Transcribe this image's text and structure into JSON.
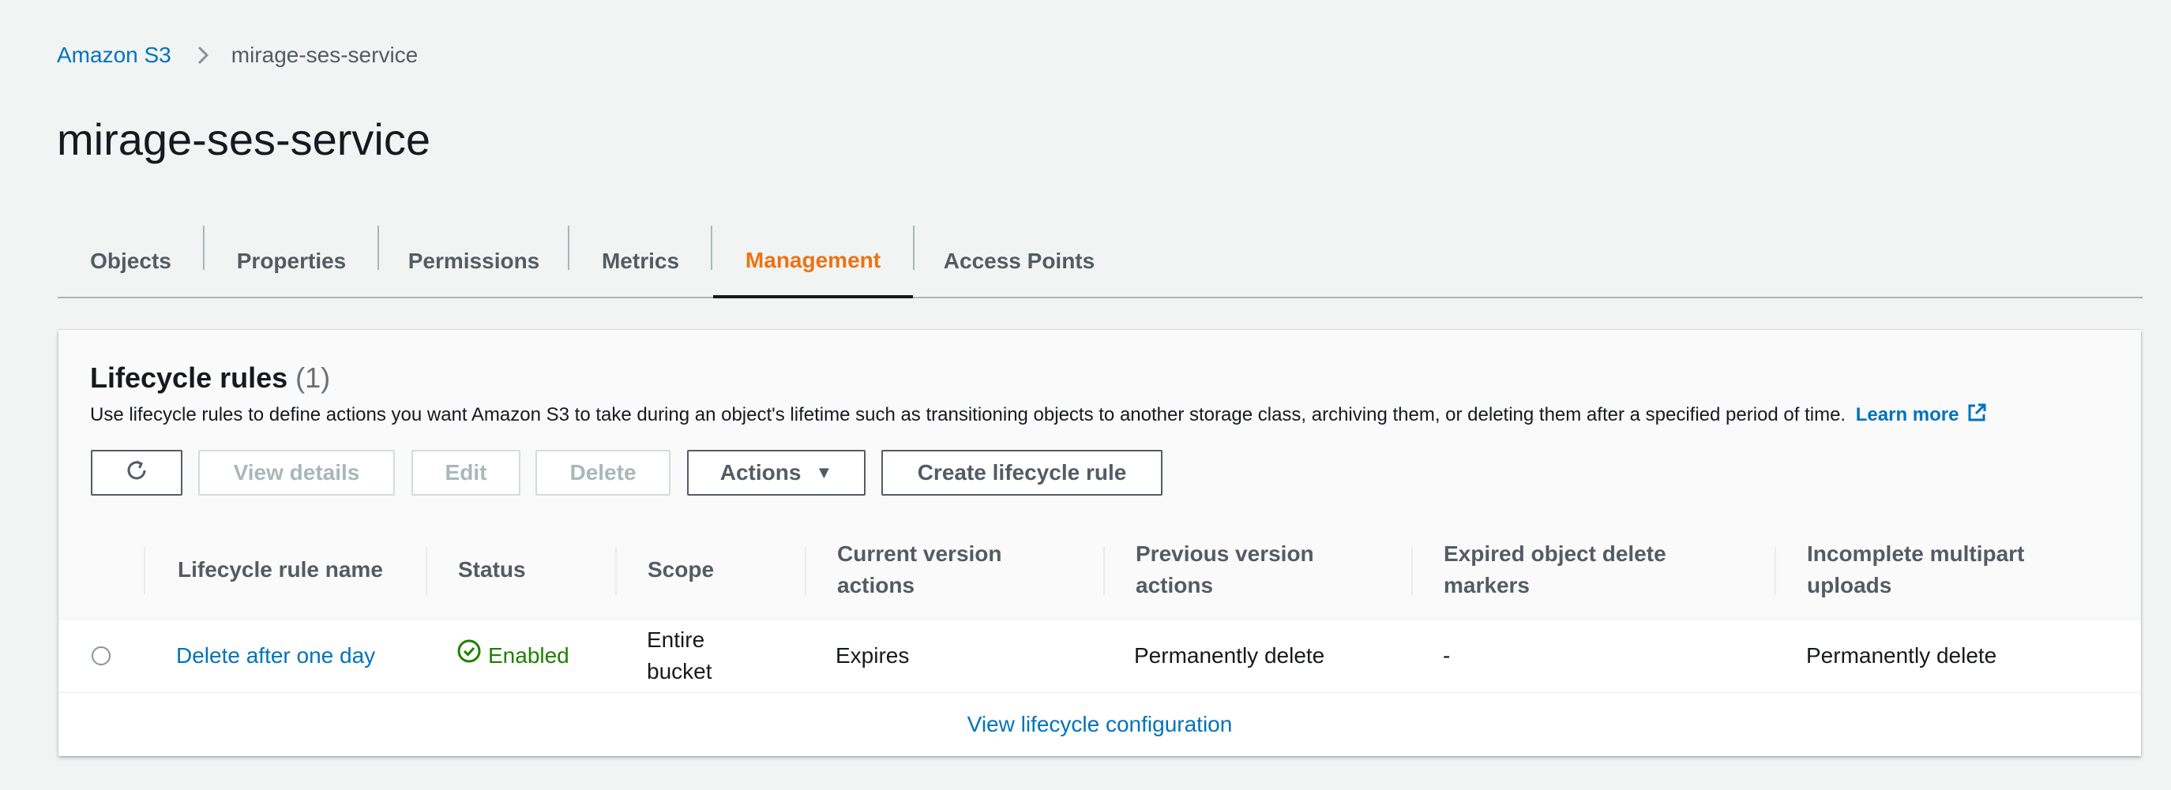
{
  "breadcrumb": {
    "root": "Amazon S3",
    "current": "mirage-ses-service"
  },
  "page": {
    "title": "mirage-ses-service"
  },
  "tabs": [
    {
      "label": "Objects",
      "active": false
    },
    {
      "label": "Properties",
      "active": false
    },
    {
      "label": "Permissions",
      "active": false
    },
    {
      "label": "Metrics",
      "active": false
    },
    {
      "label": "Management",
      "active": true
    },
    {
      "label": "Access Points",
      "active": false
    }
  ],
  "lifecycle": {
    "title": "Lifecycle rules",
    "count": "(1)",
    "description": "Use lifecycle rules to define actions you want Amazon S3 to take during an object's lifetime such as transitioning objects to another storage class, archiving them, or deleting them after a specified period of time.",
    "learn_more": "Learn more",
    "buttons": {
      "refresh_icon": "refresh-icon",
      "view_details": "View details",
      "edit": "Edit",
      "delete": "Delete",
      "actions": "Actions",
      "create": "Create lifecycle rule"
    },
    "columns": [
      "Lifecycle rule name",
      "Status",
      "Scope",
      "Current version actions",
      "Previous version actions",
      "Expired object delete markers",
      "Incomplete multipart uploads"
    ],
    "rows": [
      {
        "name": "Delete after one day",
        "status": "Enabled",
        "scope": "Entire bucket",
        "current_actions": "Expires",
        "previous_actions": "Permanently delete",
        "expired_markers": "-",
        "incomplete_uploads": "Permanently delete"
      }
    ],
    "footer_link": "View lifecycle configuration"
  },
  "colors": {
    "link": "#0073bb",
    "active_tab": "#ec7211",
    "enabled": "#1d8102",
    "background": "#f2f3f3"
  }
}
